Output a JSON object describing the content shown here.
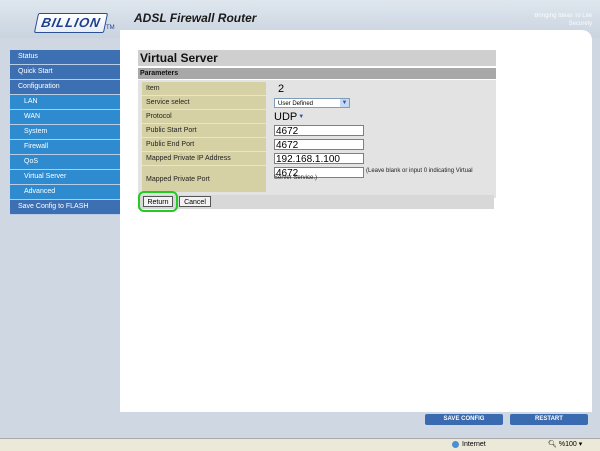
{
  "header": {
    "logo": "BILLION",
    "tm": "TM",
    "title": "ADSL Firewall Router",
    "tagline": "Bringing Ideas To Life Securely"
  },
  "sidebar": {
    "items": [
      {
        "label": "Status",
        "sub": false
      },
      {
        "label": "Quick Start",
        "sub": false
      },
      {
        "label": "Configuration",
        "sub": false
      },
      {
        "label": "LAN",
        "sub": true
      },
      {
        "label": "WAN",
        "sub": true
      },
      {
        "label": "System",
        "sub": true
      },
      {
        "label": "Firewall",
        "sub": true
      },
      {
        "label": "QoS",
        "sub": true
      },
      {
        "label": "Virtual Server",
        "sub": true
      },
      {
        "label": "Advanced",
        "sub": true
      },
      {
        "label": "Save Config to FLASH",
        "sub": false
      }
    ]
  },
  "page": {
    "title": "Virtual Server",
    "section": "Parameters"
  },
  "form": {
    "item_label": "Item",
    "item_value": "2",
    "service_label": "Service select",
    "service_value": "User Defined",
    "protocol_label": "Protocol",
    "protocol_value": "UDP",
    "start_port_label": "Public Start Port",
    "start_port_value": "4672",
    "end_port_label": "Public End Port",
    "end_port_value": "4672",
    "ip_label": "Mapped Private IP Address",
    "ip_value": "192.168.1.100",
    "private_port_label": "Mapped Private Port",
    "private_port_value": "4672",
    "private_port_hint": "(Leave blank or input 0 indicating Virtual Server Service.)"
  },
  "buttons": {
    "return": "Return",
    "cancel": "Cancel",
    "save_config": "SAVE CONFIG",
    "restart": "RESTART"
  },
  "statusbar": {
    "zone": "Internet",
    "zoom": "%100"
  },
  "colors": {
    "sidebar": "#3d6fb3",
    "sidebar_sub": "#2f8bd0",
    "label_bg": "#d6d1a4",
    "highlight": "#22cc22"
  }
}
